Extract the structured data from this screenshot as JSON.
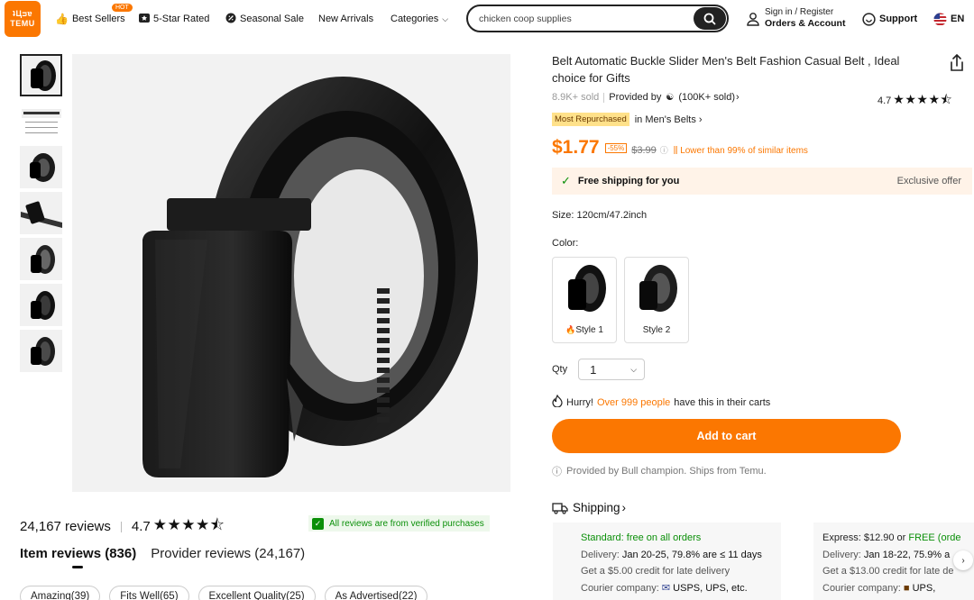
{
  "header": {
    "logo_line1": "ʇЦᴝɐ",
    "logo_line2": "TEMU",
    "nav": {
      "best_sellers": "Best Sellers",
      "hot_badge": "HOT",
      "five_star": "5-Star Rated",
      "seasonal_sale": "Seasonal Sale",
      "new_arrivals": "New Arrivals",
      "categories": "Categories"
    },
    "search": {
      "value": "chicken coop supplies"
    },
    "account": {
      "line1": "Sign in / Register",
      "line2": "Orders & Account"
    },
    "support": "Support",
    "language": "EN"
  },
  "product": {
    "title": "Belt Automatic Buckle Slider Men's Belt Fashion Casual Belt , Ideal choice for Gifts",
    "sold": "8.9K+ sold",
    "provided_by": "Provided by",
    "provider_sold": "(100K+ sold)",
    "rating": "4.7",
    "stars": "★★★★⯪",
    "repurchased_badge": "Most Repurchased",
    "category_link": "in Men's Belts",
    "price": "$1.77",
    "discount": "-55%",
    "old_price": "$3.99",
    "lower_than": "Lower than 99% of similar items",
    "free_shipping": "Free shipping for you",
    "exclusive": "Exclusive offer",
    "size": "Size: 120cm/47.2inch",
    "color_label": "Color:",
    "styles": [
      {
        "label": "Style 1"
      },
      {
        "label": "Style 2"
      }
    ],
    "qty_label": "Qty",
    "qty_value": "1",
    "hurry_prefix": "Hurry!",
    "hurry_count": "Over 999 people",
    "hurry_suffix": "have this in their carts",
    "add_to_cart": "Add to cart",
    "provided_note": "Provided by Bull champion. Ships from Temu."
  },
  "shipping": {
    "heading": "Shipping",
    "standard": {
      "title": "Standard: free on all orders",
      "delivery_label": "Delivery:",
      "delivery": "Jan 20-25, 79.8% are ≤ 11 days",
      "credit": "Get a $5.00 credit for late delivery",
      "courier_label": "Courier company:",
      "courier": "USPS,  UPS, etc."
    },
    "express": {
      "title_main": "Express: $12.90 or ",
      "title_free": "FREE (orde",
      "delivery_label": "Delivery:",
      "delivery": "Jan 18-22, 75.9% a",
      "credit": "Get a $13.00 credit for late de",
      "courier_label": "Courier company:",
      "courier": "UPS,"
    }
  },
  "reviews": {
    "count": "24,167 reviews",
    "rating": "4.7",
    "stars": "★★★★⯪",
    "verified": "All reviews are from verified purchases",
    "tabs": [
      "Item reviews (836)",
      "Provider reviews (24,167)"
    ],
    "chips": [
      "Amazing(39)",
      "Fits Well(65)",
      "Excellent Quality(25)",
      "As Advertised(22)"
    ]
  }
}
